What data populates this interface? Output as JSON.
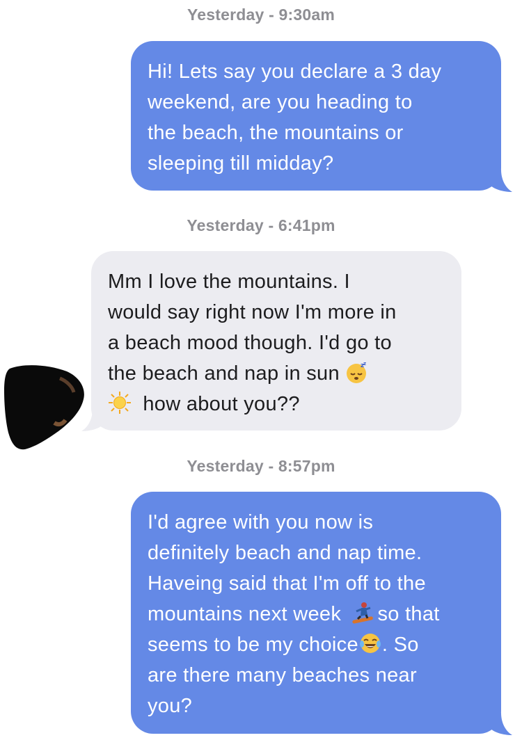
{
  "thread": {
    "messages": [
      {
        "timestamp": "Yesterday - 9:30am",
        "direction": "outgoing",
        "lines": [
          "Hi! Lets say you declare a 3 day",
          "weekend, are you heading to",
          "the beach, the mountains or",
          "sleeping till midday?"
        ]
      },
      {
        "timestamp": "Yesterday - 6:41pm",
        "direction": "incoming",
        "lines": [
          "Mm I love the mountains. I",
          "would say right now I'm more in",
          "a beach mood though. I'd go to",
          "the beach and nap in sun ",
          " how about you??"
        ]
      },
      {
        "timestamp": "Yesterday - 8:57pm",
        "direction": "outgoing",
        "lines": [
          "I'd agree with you now is",
          "definitely beach and nap time.",
          "Haveing said that I'm off to the",
          "mountains next week ",
          "so that",
          "seems to be my choice",
          ". So",
          "are there many beaches near",
          "you?"
        ]
      }
    ]
  },
  "icons": {
    "sleeping_face": "sleeping-face-emoji",
    "sun": "sun-emoji",
    "snowboarder": "snowboarder-emoji",
    "laughing": "tears-of-joy-emoji",
    "avatar": "redacted-avatar"
  },
  "colors": {
    "outgoing_bubble": "#6489e6",
    "incoming_bubble": "#ececf1",
    "timestamp": "#8e8e93"
  }
}
